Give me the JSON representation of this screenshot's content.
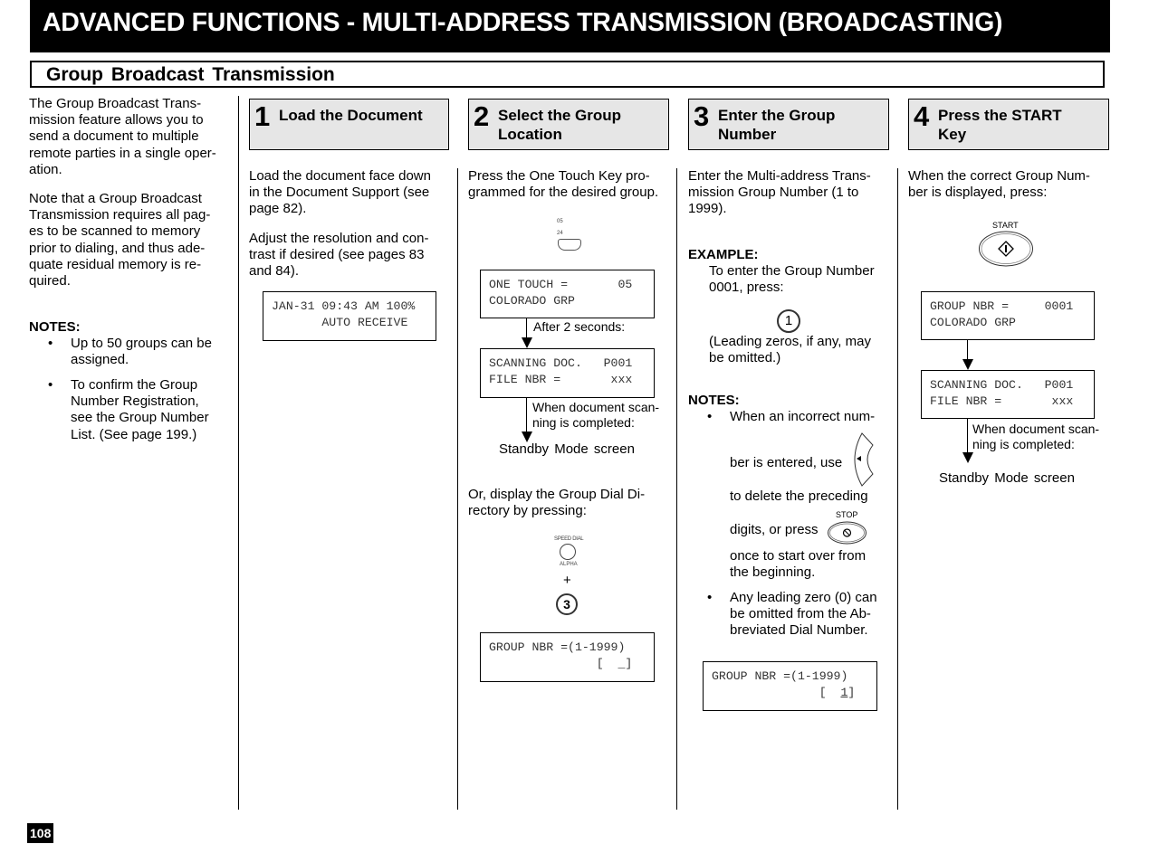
{
  "header": {
    "title": "ADVANCED FUNCTIONS - MULTI-ADDRESS TRANSMISSION (BROADCASTING)",
    "section": "Group  Broadcast  Transmission"
  },
  "intro": {
    "lines_p1": [
      "The Group Broadcast Trans-",
      "mission feature allows you to",
      "send a document to multiple",
      "remote parties in a single oper-",
      "ation."
    ],
    "lines_p2": [
      "Note that a Group Broadcast",
      "Transmission requires all pag-",
      "es to be scanned to memory",
      "prior to dialing, and thus ade-",
      "quate residual memory is re-",
      "quired."
    ],
    "notes_label": "NOTES:",
    "notes": [
      {
        "bullet": "•",
        "lines": [
          "Up to 50 groups can be",
          "assigned."
        ]
      },
      {
        "bullet": "•",
        "lines": [
          "To confirm the Group",
          "Number Registration,",
          "see the Group Number",
          "List.  (See page 199.)"
        ]
      }
    ]
  },
  "steps": [
    {
      "number": "1",
      "title_lines": [
        "Load the Document"
      ],
      "body_p1": [
        "Load the document face down",
        "in the Document Support (see",
        "page 82)."
      ],
      "body_p2": [
        "Adjust the resolution and con-",
        "trast if desired (see pages 83",
        "and 84)."
      ],
      "lcd": {
        "line1": "JAN-31 09:43 AM 100%",
        "line2": "       AUTO RECEIVE"
      }
    },
    {
      "number": "2",
      "title_lines": [
        "Select  the Group",
        "Location"
      ],
      "body_p1": [
        "Press the One Touch Key pro-",
        "grammed for the desired group."
      ],
      "one_touch_key": {
        "label_top": "05",
        "label_bottom": "24",
        "icon": "one-touch-key-icon"
      },
      "lcd1": {
        "line1": "ONE TOUCH =       05",
        "line2": "COLORADO GRP"
      },
      "after_label": "After 2 seconds:",
      "lcd2": {
        "line1": "SCANNING DOC.   P001",
        "line2": "FILE NBR =       xxx"
      },
      "when_label": [
        "When document scan-",
        "ning is completed:"
      ],
      "standby": "Standby  Mode  screen",
      "or_text": [
        "Or, display the Group Dial Di-",
        "rectory by pressing:"
      ],
      "speed_dial": {
        "label_top": "SPEED DIAL",
        "label_bottom": "ALPHA",
        "icon": "speed-dial-key-icon"
      },
      "plus": "+",
      "key3": "3",
      "lcd3": {
        "line1": "GROUP NBR =(1-1999)",
        "line2_prefix": "               [  ",
        "line2_cursor": "_",
        "line2_suffix": "]"
      }
    },
    {
      "number": "3",
      "title_lines": [
        "Enter the Group",
        "Number"
      ],
      "body_p1": [
        "Enter the Multi-address Trans-",
        "mission Group Number (1 to",
        "1999)."
      ],
      "example_label": "EXAMPLE:",
      "example_lines": [
        "To enter the Group Number",
        "0001, press:"
      ],
      "key1": "1",
      "leading_lines": [
        "(Leading zeros, if any, may",
        "be omitted.)"
      ],
      "notes_label": "NOTES:",
      "note1": {
        "bullet": "•",
        "line1": "When an incorrect num-",
        "line2": "ber is entered, use",
        "line3": "to delete the preceding",
        "stop_label": "STOP",
        "line4": "digits, or press",
        "line5": "once to start over from",
        "line6": "the beginning."
      },
      "note2": {
        "bullet": "•",
        "lines": [
          "Any leading zero (0) can",
          "be omitted from the Ab-",
          "breviated Dial Number."
        ]
      },
      "lcd": {
        "line1": "GROUP NBR =(1-1999)",
        "line2_prefix": "               [  ",
        "line2_cursor": "1",
        "line2_suffix": "]"
      }
    },
    {
      "number": "4",
      "title_lines": [
        "Press the START",
        "Key"
      ],
      "body_p1": [
        "When the correct Group Num-",
        "ber is displayed, press:"
      ],
      "start_label": "START",
      "lcd1": {
        "line1": "GROUP NBR =     0001",
        "line2": "COLORADO GRP"
      },
      "lcd2": {
        "line1": "SCANNING DOC.   P001",
        "line2": "FILE NBR =       xxx"
      },
      "when_label": [
        "When document scan-",
        "ning is completed:"
      ],
      "standby": "Standby  Mode  screen"
    }
  ],
  "footer": {
    "page_number": "108"
  }
}
